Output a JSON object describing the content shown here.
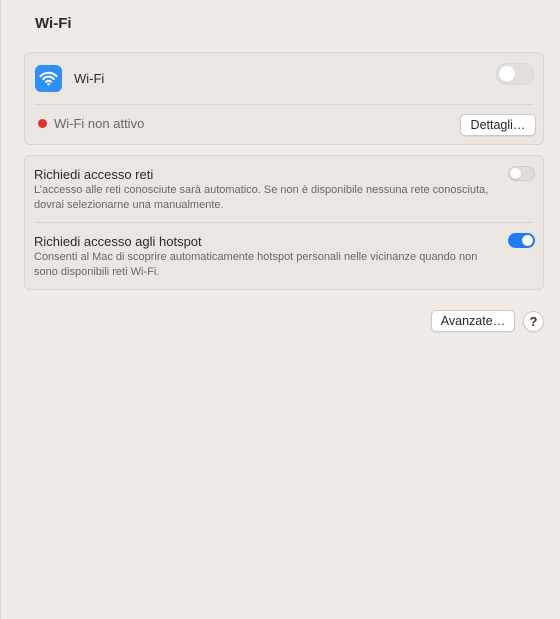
{
  "header": {
    "title": "Wi-Fi"
  },
  "wifi": {
    "icon": "wifi-icon",
    "label": "Wi-Fi",
    "enabled": false,
    "status_text": "Wi-Fi non attivo",
    "status_color": "#e0312c",
    "details_button": "Dettagli…"
  },
  "options": [
    {
      "title": "Richiedi accesso reti",
      "description": "L’accesso alle reti conosciute sarà automatico. Se non è disponibile nessuna rete conosciuta, dovrai selezionarne una manualmente.",
      "enabled": false
    },
    {
      "title": "Richiedi accesso agli hotspot",
      "description": "Consenti al Mac di scoprire automaticamente hotspot personali nelle vicinanze quando non sono disponibili reti Wi-Fi.",
      "enabled": true
    }
  ],
  "footer": {
    "advanced_button": "Avanzate…",
    "help_button": "?"
  },
  "colors": {
    "accent": "#1f7cf2",
    "wifi_icon_bg": "#2e8ff6"
  }
}
